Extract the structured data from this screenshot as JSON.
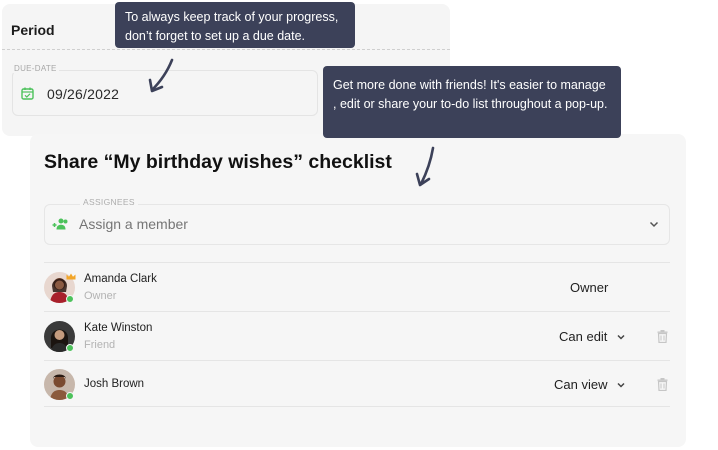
{
  "period": {
    "title": "Period",
    "due_label": "DUE-DATE",
    "due_value": "09/26/2022"
  },
  "tooltips": {
    "due_date_tip": "To always keep track of your progress, don’t forget to set up a due date.",
    "share_tip": "Get more done with friends! It's easier to manage , edit or share your to-do list throughout a pop-up."
  },
  "share": {
    "title": "Share “My birthday wishes” checklist",
    "assignees_label": "ASSIGNEES",
    "assign_placeholder": "Assign a member",
    "members": [
      {
        "name": "Amanda Clark",
        "role": "Owner",
        "permission": "Owner"
      },
      {
        "name": "Kate Winston",
        "role": "Friend",
        "permission": "Can edit"
      },
      {
        "name": "Josh Brown",
        "role": "",
        "permission": "Can view"
      }
    ]
  },
  "colors": {
    "tooltip_bg": "#3c4159",
    "accent_green": "#4cc25b",
    "owner_crown": "#f2a62a"
  },
  "icons": {
    "calendar": "calendar-icon",
    "assign": "add-group-icon",
    "chevron": "chevron-down-icon",
    "delete": "trash-icon",
    "crown": "crown-icon"
  }
}
